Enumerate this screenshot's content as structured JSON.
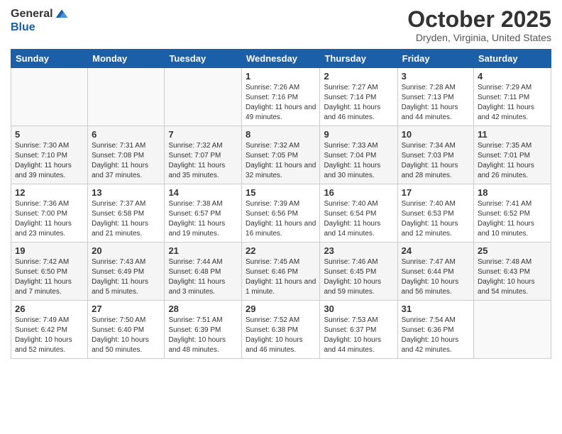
{
  "logo": {
    "general": "General",
    "blue": "Blue"
  },
  "header": {
    "month": "October 2025",
    "location": "Dryden, Virginia, United States"
  },
  "days_of_week": [
    "Sunday",
    "Monday",
    "Tuesday",
    "Wednesday",
    "Thursday",
    "Friday",
    "Saturday"
  ],
  "weeks": [
    [
      {
        "day": "",
        "info": ""
      },
      {
        "day": "",
        "info": ""
      },
      {
        "day": "",
        "info": ""
      },
      {
        "day": "1",
        "info": "Sunrise: 7:26 AM\nSunset: 7:16 PM\nDaylight: 11 hours and 49 minutes."
      },
      {
        "day": "2",
        "info": "Sunrise: 7:27 AM\nSunset: 7:14 PM\nDaylight: 11 hours and 46 minutes."
      },
      {
        "day": "3",
        "info": "Sunrise: 7:28 AM\nSunset: 7:13 PM\nDaylight: 11 hours and 44 minutes."
      },
      {
        "day": "4",
        "info": "Sunrise: 7:29 AM\nSunset: 7:11 PM\nDaylight: 11 hours and 42 minutes."
      }
    ],
    [
      {
        "day": "5",
        "info": "Sunrise: 7:30 AM\nSunset: 7:10 PM\nDaylight: 11 hours and 39 minutes."
      },
      {
        "day": "6",
        "info": "Sunrise: 7:31 AM\nSunset: 7:08 PM\nDaylight: 11 hours and 37 minutes."
      },
      {
        "day": "7",
        "info": "Sunrise: 7:32 AM\nSunset: 7:07 PM\nDaylight: 11 hours and 35 minutes."
      },
      {
        "day": "8",
        "info": "Sunrise: 7:32 AM\nSunset: 7:05 PM\nDaylight: 11 hours and 32 minutes."
      },
      {
        "day": "9",
        "info": "Sunrise: 7:33 AM\nSunset: 7:04 PM\nDaylight: 11 hours and 30 minutes."
      },
      {
        "day": "10",
        "info": "Sunrise: 7:34 AM\nSunset: 7:03 PM\nDaylight: 11 hours and 28 minutes."
      },
      {
        "day": "11",
        "info": "Sunrise: 7:35 AM\nSunset: 7:01 PM\nDaylight: 11 hours and 26 minutes."
      }
    ],
    [
      {
        "day": "12",
        "info": "Sunrise: 7:36 AM\nSunset: 7:00 PM\nDaylight: 11 hours and 23 minutes."
      },
      {
        "day": "13",
        "info": "Sunrise: 7:37 AM\nSunset: 6:58 PM\nDaylight: 11 hours and 21 minutes."
      },
      {
        "day": "14",
        "info": "Sunrise: 7:38 AM\nSunset: 6:57 PM\nDaylight: 11 hours and 19 minutes."
      },
      {
        "day": "15",
        "info": "Sunrise: 7:39 AM\nSunset: 6:56 PM\nDaylight: 11 hours and 16 minutes."
      },
      {
        "day": "16",
        "info": "Sunrise: 7:40 AM\nSunset: 6:54 PM\nDaylight: 11 hours and 14 minutes."
      },
      {
        "day": "17",
        "info": "Sunrise: 7:40 AM\nSunset: 6:53 PM\nDaylight: 11 hours and 12 minutes."
      },
      {
        "day": "18",
        "info": "Sunrise: 7:41 AM\nSunset: 6:52 PM\nDaylight: 11 hours and 10 minutes."
      }
    ],
    [
      {
        "day": "19",
        "info": "Sunrise: 7:42 AM\nSunset: 6:50 PM\nDaylight: 11 hours and 7 minutes."
      },
      {
        "day": "20",
        "info": "Sunrise: 7:43 AM\nSunset: 6:49 PM\nDaylight: 11 hours and 5 minutes."
      },
      {
        "day": "21",
        "info": "Sunrise: 7:44 AM\nSunset: 6:48 PM\nDaylight: 11 hours and 3 minutes."
      },
      {
        "day": "22",
        "info": "Sunrise: 7:45 AM\nSunset: 6:46 PM\nDaylight: 11 hours and 1 minute."
      },
      {
        "day": "23",
        "info": "Sunrise: 7:46 AM\nSunset: 6:45 PM\nDaylight: 10 hours and 59 minutes."
      },
      {
        "day": "24",
        "info": "Sunrise: 7:47 AM\nSunset: 6:44 PM\nDaylight: 10 hours and 56 minutes."
      },
      {
        "day": "25",
        "info": "Sunrise: 7:48 AM\nSunset: 6:43 PM\nDaylight: 10 hours and 54 minutes."
      }
    ],
    [
      {
        "day": "26",
        "info": "Sunrise: 7:49 AM\nSunset: 6:42 PM\nDaylight: 10 hours and 52 minutes."
      },
      {
        "day": "27",
        "info": "Sunrise: 7:50 AM\nSunset: 6:40 PM\nDaylight: 10 hours and 50 minutes."
      },
      {
        "day": "28",
        "info": "Sunrise: 7:51 AM\nSunset: 6:39 PM\nDaylight: 10 hours and 48 minutes."
      },
      {
        "day": "29",
        "info": "Sunrise: 7:52 AM\nSunset: 6:38 PM\nDaylight: 10 hours and 46 minutes."
      },
      {
        "day": "30",
        "info": "Sunrise: 7:53 AM\nSunset: 6:37 PM\nDaylight: 10 hours and 44 minutes."
      },
      {
        "day": "31",
        "info": "Sunrise: 7:54 AM\nSunset: 6:36 PM\nDaylight: 10 hours and 42 minutes."
      },
      {
        "day": "",
        "info": ""
      }
    ]
  ]
}
